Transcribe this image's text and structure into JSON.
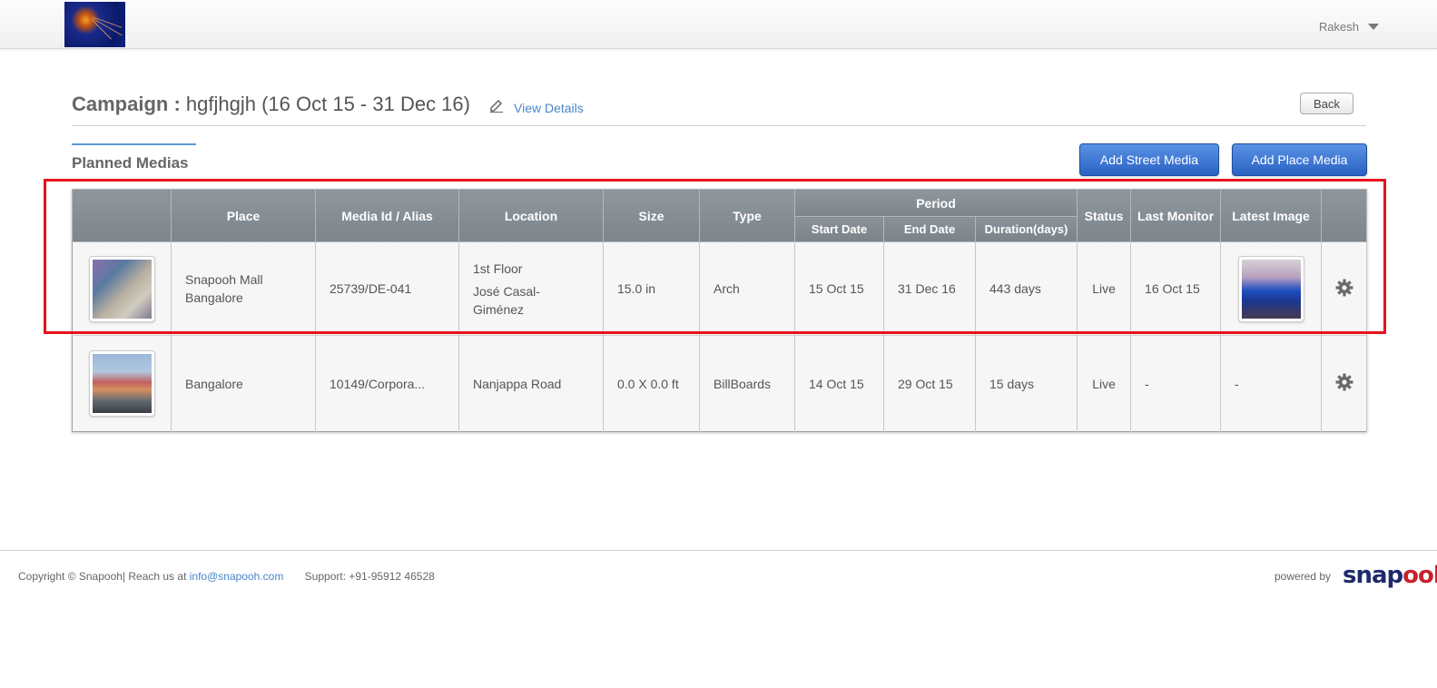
{
  "header": {
    "user_name": "Rakesh"
  },
  "campaign": {
    "label": "Campaign :",
    "name": "hgfjhgjh (16 Oct 15 - 31 Dec 16)",
    "view_details": "View Details",
    "back": "Back"
  },
  "section": {
    "title": "Planned Medias",
    "add_street": "Add Street Media",
    "add_place": "Add Place Media"
  },
  "table": {
    "headers": {
      "place": "Place",
      "media_id": "Media Id / Alias",
      "location": "Location",
      "size": "Size",
      "type": "Type",
      "period": "Period",
      "start": "Start Date",
      "end": "End Date",
      "duration": "Duration(days)",
      "status": "Status",
      "last_monitor": "Last Monitor",
      "latest_image": "Latest Image"
    },
    "rows": [
      {
        "place_line1": "Snapooh Mall",
        "place_line2": "Bangalore",
        "media_id": "25739/DE-041",
        "location_line1": "1st Floor",
        "location_line2": "José Casal-Giménez",
        "size": "15.0 in",
        "type": "Arch",
        "start": "15 Oct 15",
        "end": "31 Dec 16",
        "duration": "443 days",
        "status": "Live",
        "last_monitor": "16 Oct 15"
      },
      {
        "place_line1": "Bangalore",
        "media_id": "10149/Corpora...",
        "location_line1": "Nanjappa Road",
        "size": "0.0 X 0.0 ft",
        "type": "BillBoards",
        "start": "14 Oct 15",
        "end": "29 Oct 15",
        "duration": "15 days",
        "status": "Live",
        "last_monitor": "-",
        "latest_image": "-"
      }
    ]
  },
  "footer": {
    "copyright": "Copyright © Snapooh| Reach us at ",
    "email": "info@snapooh.com",
    "support": "Support: +91-95912 46528",
    "powered_by": "powered by",
    "brand_part1": "snap",
    "brand_part2": "ooh"
  },
  "colors": {
    "accent_blue": "#2a62c4",
    "link_blue": "#4a86c8",
    "highlight_red": "#e8121b",
    "brand_navy": "#1e2a6a",
    "brand_red": "#c8202a"
  }
}
